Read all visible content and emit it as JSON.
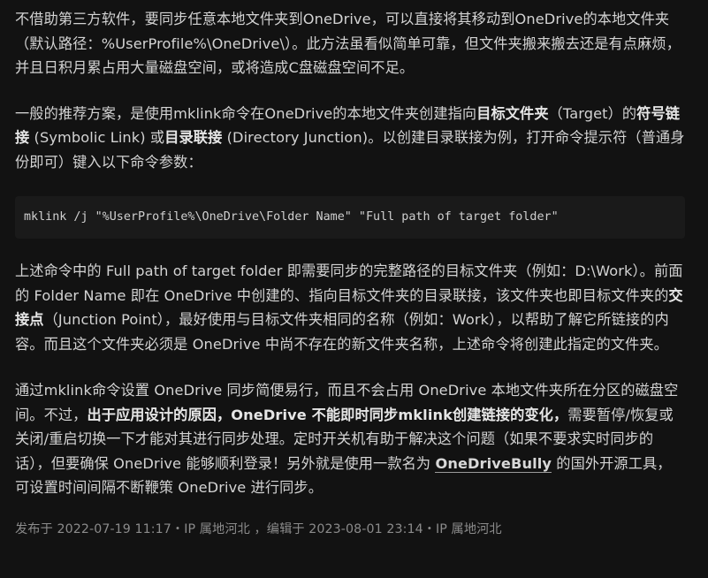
{
  "p1": {
    "text": "不借助第三方软件，要同步任意本地文件夹到OneDrive，可以直接将其移动到OneDrive的本地文件夹（默认路径：%UserProfile%\\OneDrive\\）。此方法虽看似简单可靠，但文件夹搬来搬去还是有点麻烦，并且日积月累占用大量磁盘空间，或将造成C盘磁盘空间不足。"
  },
  "p2": {
    "part1": "一般的推荐方案，是使用mklink命令在OneDrive的本地文件夹创建指向",
    "bold1": "目标文件夹",
    "part2": "（Target）的",
    "bold2": "符号链接",
    "part3": " (Symbolic Link) 或",
    "bold3": "目录联接",
    "part4": " (Directory Junction)。以创建目录联接为例，打开命令提示符（普通身份即可）键入以下命令参数："
  },
  "code": {
    "command": "mklink /j \"%UserProfile%\\OneDrive\\Folder Name\" \"Full path of target folder\""
  },
  "p3": {
    "part1": "上述命令中的 Full path of target folder 即需要同步的完整路径的目标文件夹（例如：D:\\Work）。前面的 Folder Name 即在 OneDrive 中创建的、指向目标文件夹的目录联接，该文件夹也即目标文件夹的",
    "bold1": "交接点",
    "part2": "（Junction Point），最好使用与目标文件夹相同的名称（例如：Work），以帮助了解它所链接的内容。而且这个文件夹必须是 OneDrive 中尚不存在的新文件夹名称，上述命令将创建此指定的文件夹。"
  },
  "p4": {
    "part1": "通过mklink命令设置 OneDrive 同步简便易行，而且不会占用 OneDrive 本地文件夹所在分区的磁盘空间。不过，",
    "bold1": "出于应用设计的原因，OneDrive 不能即时同步mklink创建链接的变化，",
    "part2": "需要暂停/恢复或关闭/重启切换一下才能对其进行同步处理。定时开关机有助于解决这个问题（如果不要求实时同步的话），但要确保 OneDrive 能够顺利登录！另外就是使用一款名为 ",
    "link": "OneDriveBully",
    "part3": " 的国外开源工具，可设置时间间隔不断鞭策 OneDrive 进行同步。"
  },
  "meta": {
    "text": "发布于 2022-07-19 11:17・IP 属地河北 ，编辑于 2023-08-01 23:14・IP 属地河北"
  }
}
